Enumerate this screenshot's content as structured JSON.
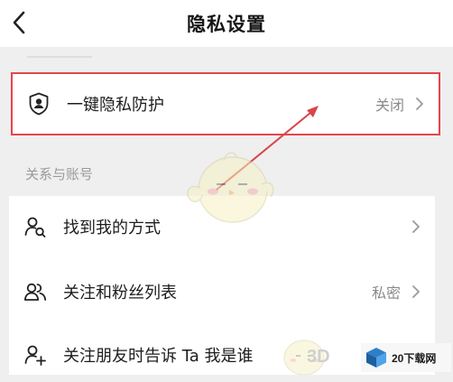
{
  "header": {
    "title": "隐私设置",
    "back_icon": "chevron-left-icon"
  },
  "privacy_guard": {
    "label": "一键隐私防护",
    "value": "关闭",
    "icon": "shield-user-icon"
  },
  "section": {
    "title": "关系与账号"
  },
  "items": [
    {
      "label": "找到我的方式",
      "value": "",
      "icon": "user-search-icon"
    },
    {
      "label": "关注和粉丝列表",
      "value": "私密",
      "icon": "users-icon"
    },
    {
      "label": "关注朋友时告诉 Ta 我是谁",
      "value": "",
      "icon": "user-add-icon"
    }
  ],
  "watermark": {
    "site_text": "20下载网",
    "brand_text": "3D"
  },
  "colors": {
    "highlight_border": "#e4464a",
    "background": "#efefef",
    "card": "#ffffff",
    "value_text": "#8a8a8a",
    "section_text": "#9a9a9a"
  }
}
